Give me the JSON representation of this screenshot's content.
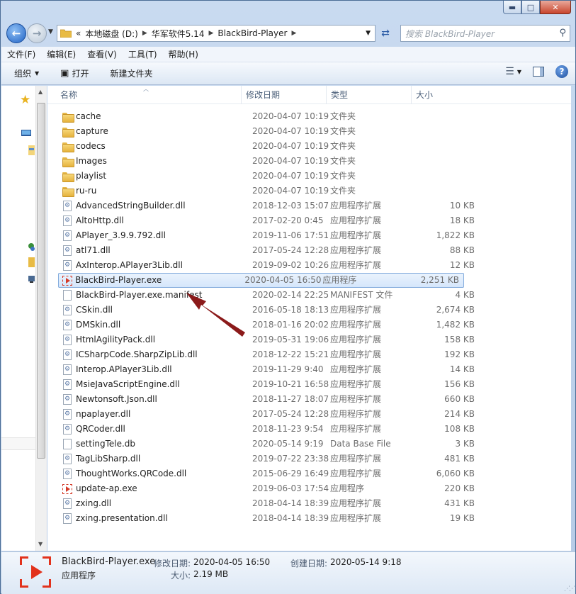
{
  "window": {
    "caption_buttons": {
      "minimize": "▬",
      "maximize": "□",
      "close": "✕"
    }
  },
  "address": {
    "overflow": "«",
    "crumbs": [
      "本地磁盘 (D:)",
      "华军软件5.14",
      "BlackBird-Player"
    ],
    "search_placeholder": "搜索 BlackBird-Player"
  },
  "menubar": {
    "items": [
      "文件(F)",
      "编辑(E)",
      "查看(V)",
      "工具(T)",
      "帮助(H)"
    ]
  },
  "toolbar": {
    "organize": "组织",
    "open": "打开",
    "new_folder": "新建文件夹"
  },
  "columns": {
    "name": "名称",
    "date": "修改日期",
    "type": "类型",
    "size": "大小"
  },
  "files": [
    {
      "name": "cache",
      "date": "2020-04-07 10:19",
      "type": "文件夹",
      "size": "",
      "kind": "folder"
    },
    {
      "name": "capture",
      "date": "2020-04-07 10:19",
      "type": "文件夹",
      "size": "",
      "kind": "folder"
    },
    {
      "name": "codecs",
      "date": "2020-04-07 10:19",
      "type": "文件夹",
      "size": "",
      "kind": "folder"
    },
    {
      "name": "Images",
      "date": "2020-04-07 10:19",
      "type": "文件夹",
      "size": "",
      "kind": "folder"
    },
    {
      "name": "playlist",
      "date": "2020-04-07 10:19",
      "type": "文件夹",
      "size": "",
      "kind": "folder"
    },
    {
      "name": "ru-ru",
      "date": "2020-04-07 10:19",
      "type": "文件夹",
      "size": "",
      "kind": "folder"
    },
    {
      "name": "AdvancedStringBuilder.dll",
      "date": "2018-12-03 15:07",
      "type": "应用程序扩展",
      "size": "10 KB",
      "kind": "dll"
    },
    {
      "name": "AltoHttp.dll",
      "date": "2017-02-20 0:45",
      "type": "应用程序扩展",
      "size": "18 KB",
      "kind": "dll"
    },
    {
      "name": "APlayer_3.9.9.792.dll",
      "date": "2019-11-06 17:51",
      "type": "应用程序扩展",
      "size": "1,822 KB",
      "kind": "dll"
    },
    {
      "name": "atl71.dll",
      "date": "2017-05-24 12:28",
      "type": "应用程序扩展",
      "size": "88 KB",
      "kind": "dll"
    },
    {
      "name": "AxInterop.APlayer3Lib.dll",
      "date": "2019-09-02 10:26",
      "type": "应用程序扩展",
      "size": "12 KB",
      "kind": "dll"
    },
    {
      "name": "BlackBird-Player.exe",
      "date": "2020-04-05 16:50",
      "type": "应用程序",
      "size": "2,251 KB",
      "kind": "exe",
      "selected": true
    },
    {
      "name": "BlackBird-Player.exe.manifest",
      "date": "2020-02-14 22:25",
      "type": "MANIFEST 文件",
      "size": "4 KB",
      "kind": "file"
    },
    {
      "name": "CSkin.dll",
      "date": "2016-05-18 18:13",
      "type": "应用程序扩展",
      "size": "2,674 KB",
      "kind": "dll"
    },
    {
      "name": "DMSkin.dll",
      "date": "2018-01-16 20:02",
      "type": "应用程序扩展",
      "size": "1,482 KB",
      "kind": "dll"
    },
    {
      "name": "HtmlAgilityPack.dll",
      "date": "2019-05-31 19:06",
      "type": "应用程序扩展",
      "size": "158 KB",
      "kind": "dll"
    },
    {
      "name": "ICSharpCode.SharpZipLib.dll",
      "date": "2018-12-22 15:21",
      "type": "应用程序扩展",
      "size": "192 KB",
      "kind": "dll"
    },
    {
      "name": "Interop.APlayer3Lib.dll",
      "date": "2019-11-29 9:40",
      "type": "应用程序扩展",
      "size": "14 KB",
      "kind": "dll"
    },
    {
      "name": "MsieJavaScriptEngine.dll",
      "date": "2019-10-21 16:58",
      "type": "应用程序扩展",
      "size": "156 KB",
      "kind": "dll"
    },
    {
      "name": "Newtonsoft.Json.dll",
      "date": "2018-11-27 18:07",
      "type": "应用程序扩展",
      "size": "660 KB",
      "kind": "dll"
    },
    {
      "name": "npaplayer.dll",
      "date": "2017-05-24 12:28",
      "type": "应用程序扩展",
      "size": "214 KB",
      "kind": "dll"
    },
    {
      "name": "QRCoder.dll",
      "date": "2018-11-23 9:54",
      "type": "应用程序扩展",
      "size": "108 KB",
      "kind": "dll"
    },
    {
      "name": "settingTele.db",
      "date": "2020-05-14 9:19",
      "type": "Data Base File",
      "size": "3 KB",
      "kind": "file"
    },
    {
      "name": "TagLibSharp.dll",
      "date": "2019-07-22 23:38",
      "type": "应用程序扩展",
      "size": "481 KB",
      "kind": "dll"
    },
    {
      "name": "ThoughtWorks.QRCode.dll",
      "date": "2015-06-29 16:49",
      "type": "应用程序扩展",
      "size": "6,060 KB",
      "kind": "dll"
    },
    {
      "name": "update-ap.exe",
      "date": "2019-06-03 17:54",
      "type": "应用程序",
      "size": "220 KB",
      "kind": "exe"
    },
    {
      "name": "zxing.dll",
      "date": "2018-04-14 18:39",
      "type": "应用程序扩展",
      "size": "431 KB",
      "kind": "dll"
    },
    {
      "name": "zxing.presentation.dll",
      "date": "2018-04-14 18:39",
      "type": "应用程序扩展",
      "size": "19 KB",
      "kind": "dll"
    }
  ],
  "details": {
    "name": "BlackBird-Player.exe",
    "type": "应用程序",
    "modified_label": "修改日期:",
    "modified_value": "2020-04-05 16:50",
    "created_label": "创建日期:",
    "created_value": "2020-05-14 9:18",
    "size_label": "大小:",
    "size_value": "2.19 MB"
  },
  "colors": {
    "selection_border": "#84acdd",
    "annotation_arrow": "#8b1a1a",
    "exe_red": "#e2321c"
  }
}
